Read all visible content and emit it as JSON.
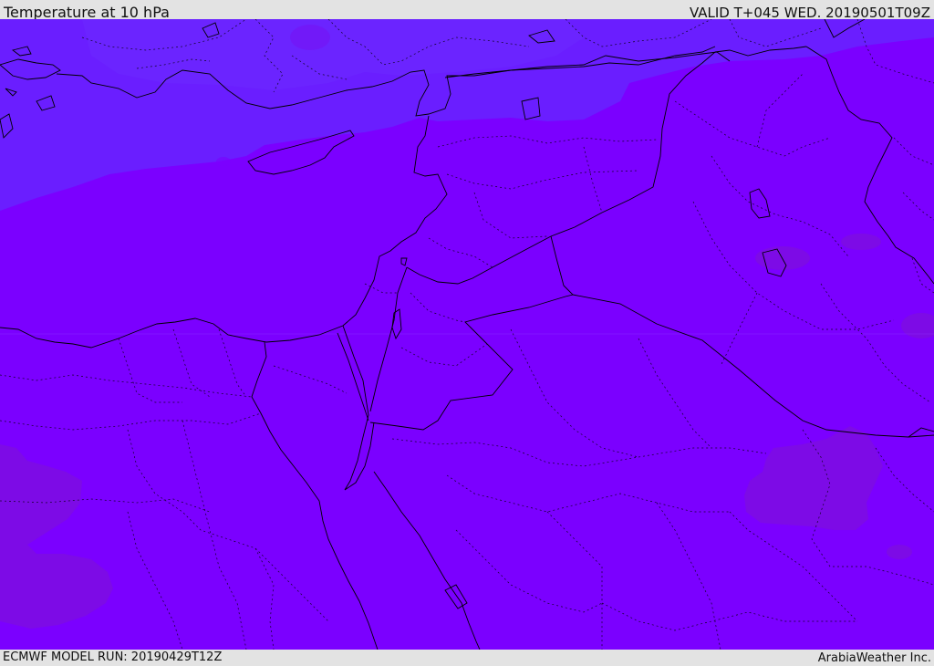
{
  "header": {
    "title": "Temperature at 10 hPa",
    "valid_time": "VALID T+045 WED. 20190501T09Z"
  },
  "footer": {
    "model_run": "ECMWF MODEL RUN: 20190429T12Z",
    "credit": "ArabiaWeather Inc."
  },
  "map": {
    "field_colors": {
      "base": "#7b00ff",
      "cool": "#6a1eff",
      "warm": "#7d0be6"
    },
    "line_color": "#000000"
  }
}
